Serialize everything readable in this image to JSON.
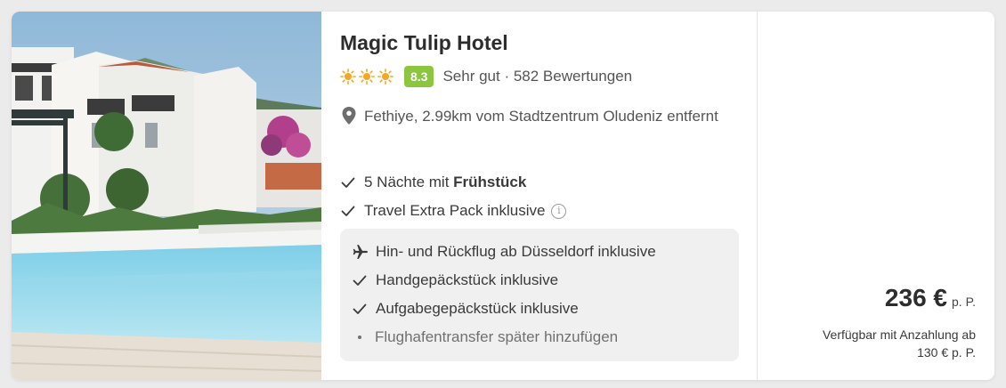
{
  "hotel": {
    "name": "Magic Tulip Hotel",
    "sun_rating": 3,
    "score": "8.3",
    "rating_text": "Sehr gut · 582 Bewertungen",
    "location": "Fethiye, 2.99km vom Stadtzentrum Oludeniz entfernt"
  },
  "features": {
    "nights_prefix": "5 Nächte mit ",
    "board": "Frühstück",
    "travel_pack": "Travel Extra Pack inklusive"
  },
  "flight": {
    "route": "Hin- und Rückflug ab Düsseldorf inklusive",
    "hand_luggage": "Handgepäckstück inklusive",
    "checked_luggage": "Aufgabegepäckstück inklusive",
    "transfer": "Flughafentransfer später hinzufügen"
  },
  "price": {
    "amount": "236 €",
    "unit": "p. P.",
    "deposit_line1": "Verfügbar mit Anzahlung ab",
    "deposit_line2": "130 € p. P."
  },
  "colors": {
    "score_badge": "#8cc63f",
    "sun": "#f5a623",
    "box_bg": "#f0f0f0",
    "pool": "#8fd3ea"
  },
  "icons": {
    "sun": "sun-icon",
    "location": "map-pin-icon",
    "check": "check-icon",
    "info": "info-icon",
    "plane": "plane-icon",
    "bullet": "bullet-icon"
  }
}
